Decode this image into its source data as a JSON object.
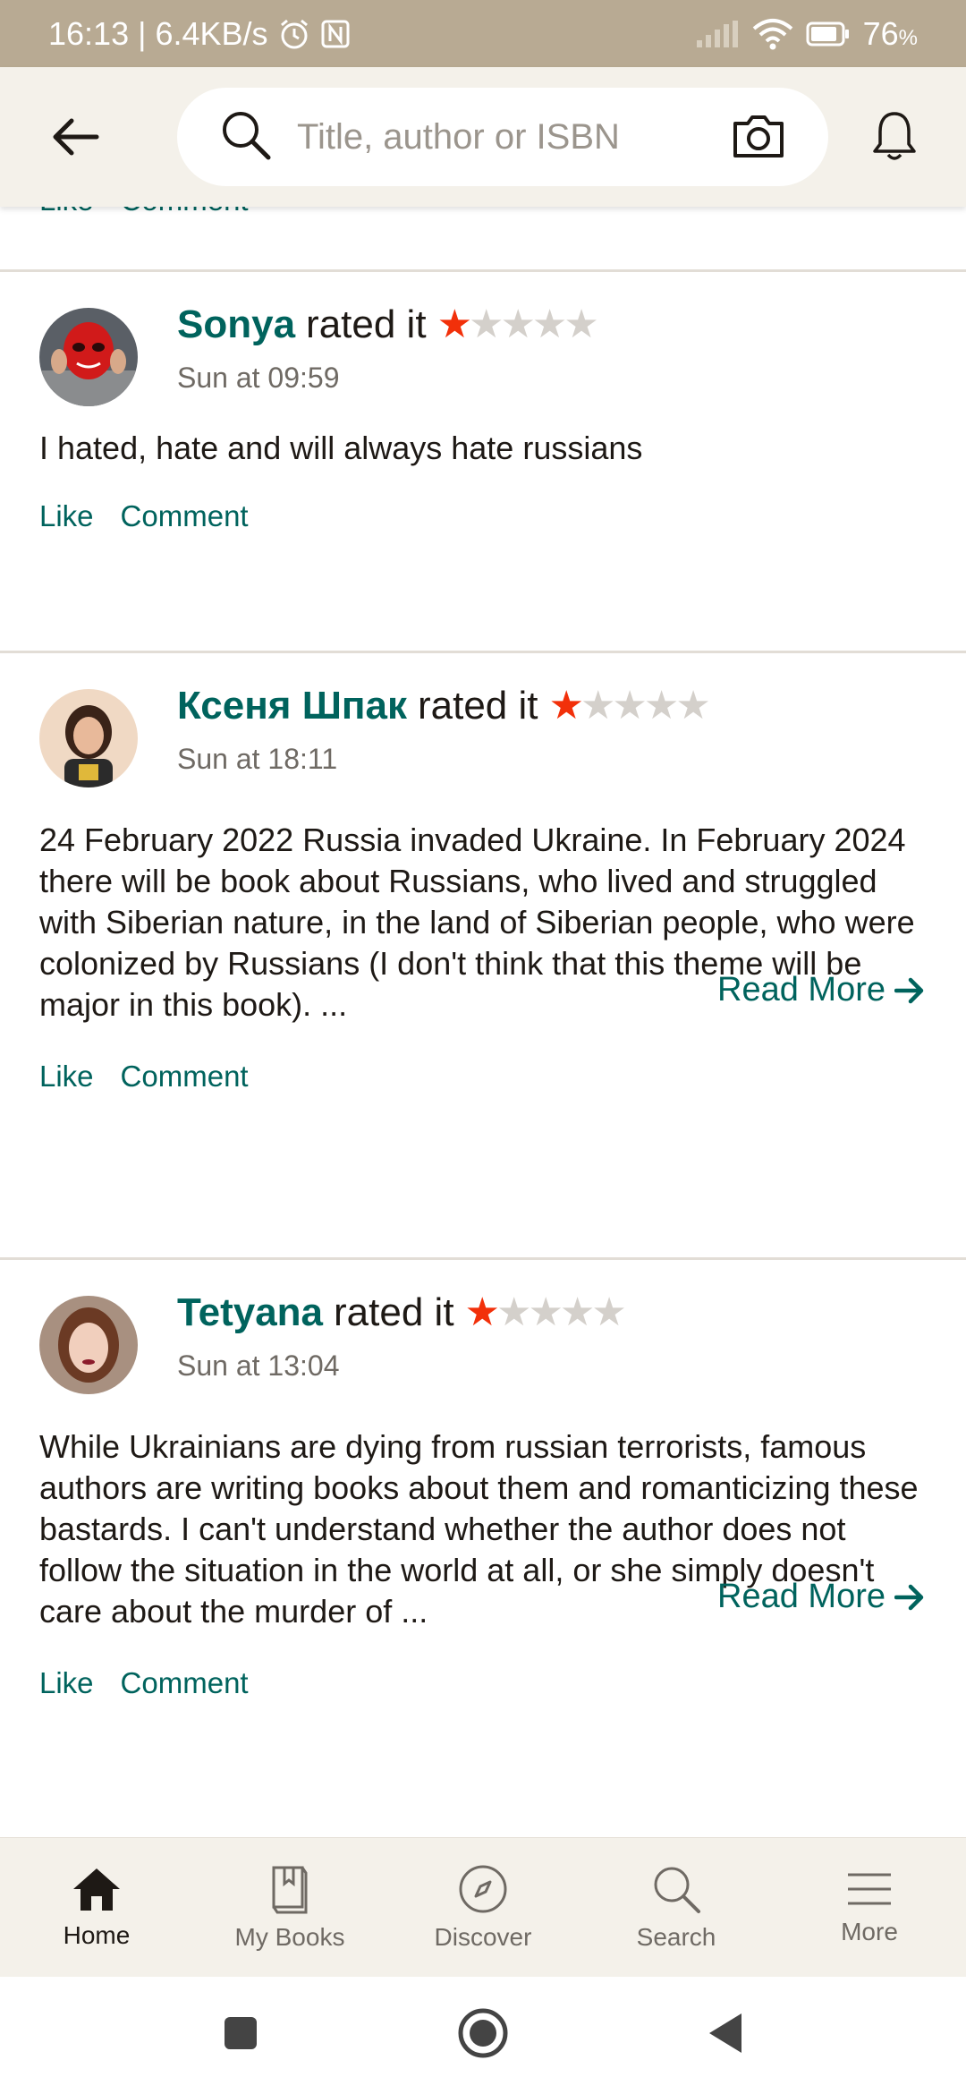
{
  "status_bar": {
    "time": "16:13",
    "speed": "6.4KB/s",
    "battery": "76",
    "battery_unit": "%"
  },
  "header": {
    "search_placeholder": "Title, author or ISBN"
  },
  "feed": {
    "partial_actions": {
      "like": "Like",
      "comment": "Comment"
    },
    "reviews": [
      {
        "name": "Sonya",
        "rated_text": "rated it",
        "rating": 1,
        "max_rating": 5,
        "time": "Sun at 09:59",
        "body": "I hated, hate and will always hate russians",
        "like": "Like",
        "comment": "Comment"
      },
      {
        "name": "Ксеня Шпак",
        "rated_text": "rated it",
        "rating": 1,
        "max_rating": 5,
        "time": "Sun at 18:11",
        "body": "24 February 2022 Russia invaded Ukraine. In February 2024 there will be book about Russians, who lived and struggled with Siberian nature, in the land of Siberian people, who were colonized by Russians (I don't think that this theme will be major in this book). ...",
        "read_more": "Read More",
        "like": "Like",
        "comment": "Comment"
      },
      {
        "name": "Tetyana",
        "rated_text": "rated it",
        "rating": 1,
        "max_rating": 5,
        "time": "Sun at 13:04",
        "body": "While Ukrainians are dying from russian terrorists, famous authors are writing books about them and romanticizing these bastards. I can't understand whether the author does not follow the situation in the world at all, or she simply doesn't care about the murder of  ...",
        "read_more": "Read More",
        "like": "Like",
        "comment": "Comment"
      }
    ]
  },
  "bottom_nav": {
    "items": [
      {
        "label": "Home",
        "icon": "home-icon",
        "active": true
      },
      {
        "label": "My Books",
        "icon": "books-icon",
        "active": false
      },
      {
        "label": "Discover",
        "icon": "compass-icon",
        "active": false
      },
      {
        "label": "Search",
        "icon": "search-icon",
        "active": false
      },
      {
        "label": "More",
        "icon": "menu-icon",
        "active": false
      }
    ]
  },
  "colors": {
    "status_bar": "#b8aa93",
    "header_bg": "#f4f1ea",
    "accent": "#00635d",
    "star": "#f2300a"
  }
}
